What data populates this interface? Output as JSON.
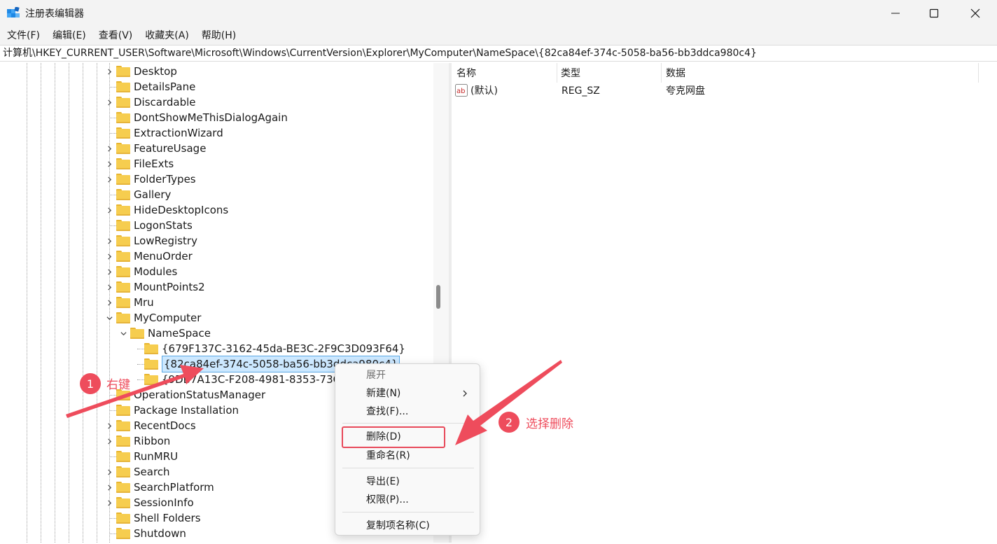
{
  "window": {
    "title": "注册表编辑器"
  },
  "menu": [
    "文件(F)",
    "编辑(E)",
    "查看(V)",
    "收藏夹(A)",
    "帮助(H)"
  ],
  "address": "计算机\\HKEY_CURRENT_USER\\Software\\Microsoft\\Windows\\CurrentVersion\\Explorer\\MyComputer\\NameSpace\\{82ca84ef-374c-5058-ba56-bb3ddca980c4}",
  "tree": {
    "items": [
      {
        "label": "Desktop",
        "expander": "collapsed"
      },
      {
        "label": "DetailsPane",
        "expander": "none"
      },
      {
        "label": "Discardable",
        "expander": "collapsed"
      },
      {
        "label": "DontShowMeThisDialogAgain",
        "expander": "none"
      },
      {
        "label": "ExtractionWizard",
        "expander": "none"
      },
      {
        "label": "FeatureUsage",
        "expander": "collapsed"
      },
      {
        "label": "FileExts",
        "expander": "collapsed"
      },
      {
        "label": "FolderTypes",
        "expander": "collapsed"
      },
      {
        "label": "Gallery",
        "expander": "none"
      },
      {
        "label": "HideDesktopIcons",
        "expander": "collapsed"
      },
      {
        "label": "LogonStats",
        "expander": "none"
      },
      {
        "label": "LowRegistry",
        "expander": "collapsed"
      },
      {
        "label": "MenuOrder",
        "expander": "collapsed"
      },
      {
        "label": "Modules",
        "expander": "collapsed"
      },
      {
        "label": "MountPoints2",
        "expander": "collapsed"
      },
      {
        "label": "Mru",
        "expander": "collapsed"
      },
      {
        "label": "MyComputer",
        "expander": "expanded"
      },
      {
        "label": "NameSpace",
        "expander": "expanded"
      },
      {
        "label": "{679F137C-3162-45da-BE3C-2F9C3D093F64}",
        "expander": "none"
      },
      {
        "label": "{82ca84ef-374c-5058-ba56-bb3ddca980c4}",
        "expander": "none",
        "selected": true
      },
      {
        "label": "{9DB7A13C-F208-4981-8353-73CC61AE2783}",
        "expander": "none"
      },
      {
        "label": "OperationStatusManager",
        "expander": "none"
      },
      {
        "label": "Package Installation",
        "expander": "none"
      },
      {
        "label": "RecentDocs",
        "expander": "collapsed"
      },
      {
        "label": "Ribbon",
        "expander": "collapsed"
      },
      {
        "label": "RunMRU",
        "expander": "none"
      },
      {
        "label": "Search",
        "expander": "collapsed"
      },
      {
        "label": "SearchPlatform",
        "expander": "collapsed"
      },
      {
        "label": "SessionInfo",
        "expander": "collapsed"
      },
      {
        "label": "Shell Folders",
        "expander": "none"
      },
      {
        "label": "Shutdown",
        "expander": "none"
      }
    ]
  },
  "values": {
    "columns": {
      "name": "名称",
      "type": "类型",
      "data": "数据"
    },
    "rows": [
      {
        "name": "(默认)",
        "type": "REG_SZ",
        "data": "夸克网盘"
      }
    ]
  },
  "context_menu": {
    "expand": "展开",
    "new": "新建(N)",
    "find": "查找(F)...",
    "delete": "删除(D)",
    "rename": "重命名(R)",
    "export": "导出(E)",
    "permissions": "权限(P)...",
    "copy_key_name": "复制项名称(C)"
  },
  "annotations": {
    "step1": {
      "number": "1",
      "text": "右键"
    },
    "step2": {
      "number": "2",
      "text": "选择删除"
    },
    "color": "#ee4c5c"
  },
  "colors": {
    "selection": "#cce8ff",
    "folder": "#f6cd4f"
  }
}
